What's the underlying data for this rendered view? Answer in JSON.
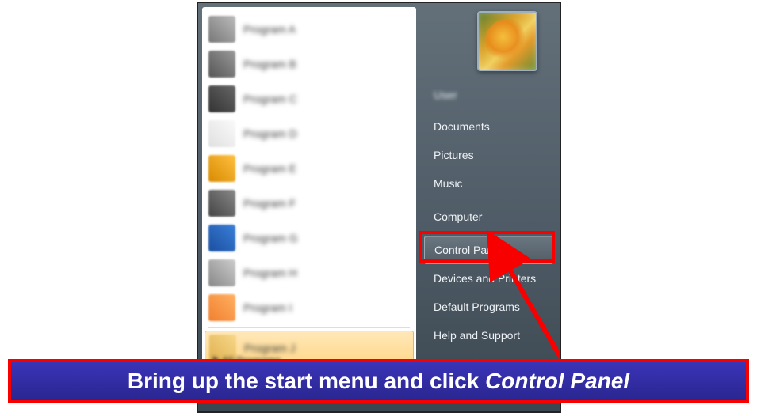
{
  "caption_prefix": "Bring up the start menu and click ",
  "caption_emph": "Control Panel",
  "user_label": "User",
  "right_items": [
    {
      "label": "Documents",
      "hover": false
    },
    {
      "label": "Pictures",
      "hover": false
    },
    {
      "label": "Music",
      "hover": false
    },
    {
      "label": "Computer",
      "hover": false
    },
    {
      "label": "Control Panel",
      "hover": true
    },
    {
      "label": "Devices and Printers",
      "hover": false
    },
    {
      "label": "Default Programs",
      "hover": false
    },
    {
      "label": "Help and Support",
      "hover": false
    }
  ],
  "programs": [
    {
      "label": "Program A",
      "icon_bg": "linear-gradient(45deg,#777,#bbb)"
    },
    {
      "label": "Program B",
      "icon_bg": "linear-gradient(45deg,#555,#999)"
    },
    {
      "label": "Program C",
      "icon_bg": "linear-gradient(45deg,#333,#666)"
    },
    {
      "label": "Program D",
      "icon_bg": "linear-gradient(45deg,#e0e0e0,#fafafa)"
    },
    {
      "label": "Program E",
      "icon_bg": "linear-gradient(45deg,#d88a00,#ffc040)"
    },
    {
      "label": "Program F",
      "icon_bg": "linear-gradient(45deg,#444,#888)"
    },
    {
      "label": "Program G",
      "icon_bg": "linear-gradient(45deg,#1a4fa0,#3a7fd8)"
    },
    {
      "label": "Program H",
      "icon_bg": "linear-gradient(45deg,#888,#ccc)"
    },
    {
      "label": "Program I",
      "icon_bg": "linear-gradient(45deg,#f08030,#ffb060)"
    },
    {
      "label": "Program J",
      "icon_bg": "linear-gradient(45deg,#e0b050,#f7d88a)",
      "highlight": true
    }
  ],
  "all_programs_label": "All Programs",
  "colors": {
    "annotation_red": "#f80000",
    "caption_bg": "#2f2aa0"
  }
}
